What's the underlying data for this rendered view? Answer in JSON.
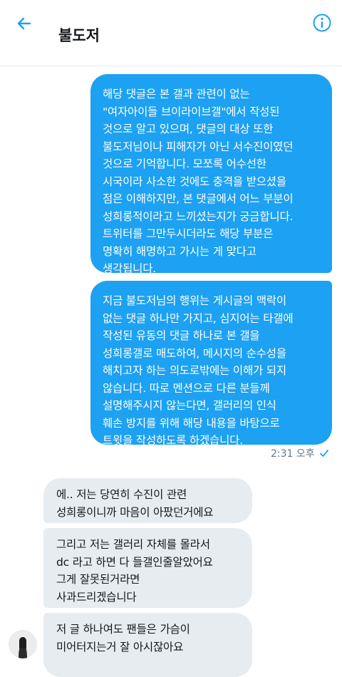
{
  "header": {
    "title": "불도저",
    "back_icon": "back-arrow-icon",
    "info_icon": "info-icon"
  },
  "colors": {
    "accent": "#1da1f2",
    "incoming_bubble": "#e6ecf0",
    "text": "#14171a",
    "meta": "#657786"
  },
  "messages": {
    "out_1": "해당 댓글은 본 갤과 관련이 없는\n\"여자아이들 브이라이브갤\"에서 작성된\n것으로 알고 있으며, 댓글의 대상 또한\n불도저님이나 피해자가 아닌 서수진이였던\n것으로 기억합니다. 모쪼록 어수선한\n시국이라 사소한 것에도 충격을 받으셨을\n점은 이해하지만, 본 댓글에서 어느 부분이\n성희롱적이라고 느끼셨는지가 궁금합니다.\n트위터를 그만두시더라도 해당 부분은\n명확히 해명하고 가시는 게 맞다고\n생각됩니다.",
    "out_2": "지금 불도저님의 행위는 게시글의 맥락이\n없는 댓글 하나만 가지고, 심지어는 타갤에\n작성된 유동의 댓글 하나로 본 갤을\n성희롱갤로 매도하여, 메시지의 순수성을\n해치고자 하는 의도로밖에는 이해가 되지\n않습니다. 따로 멘션으로 다른 분들께\n설명해주시지 않는다면, 갤러리의 인식\n훼손 방지를 위해 해당 내용을 바탕으로\n트윗을 작성하도록 하겠습니다.",
    "sent_time": "2:31 오후",
    "read_icon": "check-icon",
    "in_1": "에.. 저는 당연히 수진이 관련\n성희롱이니까 마음이 아팠던거에요",
    "in_2": "그리고 저는 갤러리 자체를 몰라서\ndc 라고 하면 다 들갤인줄알았어요\n그게 잘못된거라면\n사과드리겠습니다",
    "in_3": "저 글 하나여도 팬들은 가슴이\n미어터지는거 잘 아시잖아요",
    "avatar_icon": "avatar-icon"
  }
}
